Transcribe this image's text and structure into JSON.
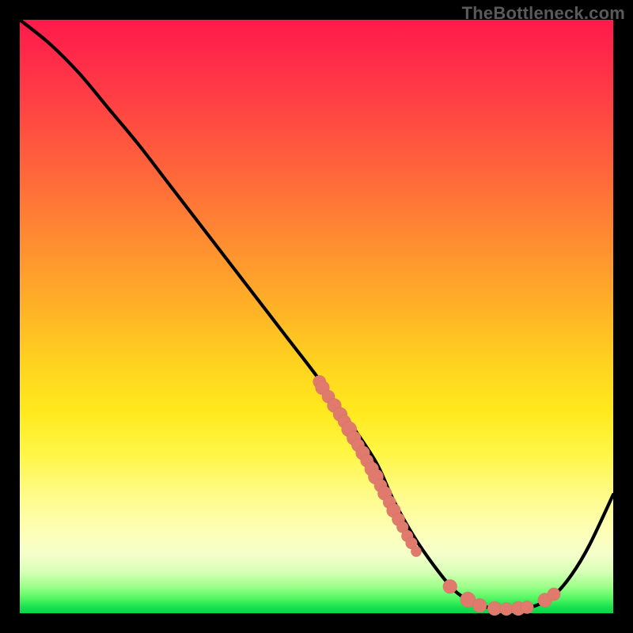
{
  "attribution": "TheBottleneck.com",
  "colors": {
    "dot": "#e07a6d",
    "line": "#000000"
  },
  "chart_data": {
    "type": "line",
    "title": "",
    "xlabel": "",
    "ylabel": "",
    "xlim": [
      0,
      100
    ],
    "ylim": [
      0,
      100
    ],
    "grid": false,
    "legend": false,
    "series": [
      {
        "name": "bottleneck-curve",
        "x": [
          0,
          5,
          10,
          15,
          20,
          25,
          30,
          35,
          40,
          45,
          50,
          55,
          60,
          63,
          67,
          72,
          75,
          78,
          81,
          84,
          87,
          90,
          93,
          96,
          100
        ],
        "y": [
          100,
          96,
          91,
          85,
          79,
          72.5,
          66,
          59.5,
          53,
          46.5,
          40,
          33,
          25.5,
          19,
          12,
          5.2,
          2.5,
          1.2,
          0.7,
          0.7,
          1.3,
          3.0,
          6.5,
          11.5,
          20
        ]
      }
    ],
    "scatter": [
      {
        "name": "sample-points",
        "points": [
          {
            "x": 50.5,
            "y": 39,
            "r": 1.1
          },
          {
            "x": 51.0,
            "y": 38,
            "r": 1.2
          },
          {
            "x": 52.0,
            "y": 36.5,
            "r": 1.1
          },
          {
            "x": 53.0,
            "y": 35,
            "r": 1.2
          },
          {
            "x": 54.0,
            "y": 33.5,
            "r": 1.2
          },
          {
            "x": 54.7,
            "y": 32.3,
            "r": 1.1
          },
          {
            "x": 55.5,
            "y": 31,
            "r": 1.3
          },
          {
            "x": 56.3,
            "y": 29.5,
            "r": 1.2
          },
          {
            "x": 57.0,
            "y": 28.3,
            "r": 1.1
          },
          {
            "x": 57.8,
            "y": 27,
            "r": 1.2
          },
          {
            "x": 58.5,
            "y": 25.7,
            "r": 1.1
          },
          {
            "x": 59.3,
            "y": 24.3,
            "r": 1.2
          },
          {
            "x": 60.0,
            "y": 23,
            "r": 1.3
          },
          {
            "x": 60.8,
            "y": 21.5,
            "r": 1.1
          },
          {
            "x": 61.5,
            "y": 20.2,
            "r": 1.2
          },
          {
            "x": 62.3,
            "y": 18.7,
            "r": 1.1
          },
          {
            "x": 63.0,
            "y": 17.3,
            "r": 1.2
          },
          {
            "x": 63.8,
            "y": 15.8,
            "r": 1.1
          },
          {
            "x": 64.5,
            "y": 14.5,
            "r": 1.0
          },
          {
            "x": 65.3,
            "y": 13,
            "r": 1.0
          },
          {
            "x": 66.0,
            "y": 11.8,
            "r": 1.0
          },
          {
            "x": 66.8,
            "y": 10.4,
            "r": 0.9
          },
          {
            "x": 72.5,
            "y": 4.5,
            "r": 1.2
          },
          {
            "x": 75.5,
            "y": 2.3,
            "r": 1.3
          },
          {
            "x": 77.5,
            "y": 1.3,
            "r": 1.2
          },
          {
            "x": 80.0,
            "y": 0.8,
            "r": 1.2
          },
          {
            "x": 82.0,
            "y": 0.7,
            "r": 1.1
          },
          {
            "x": 84.0,
            "y": 0.8,
            "r": 1.2
          },
          {
            "x": 85.5,
            "y": 1.0,
            "r": 1.1
          },
          {
            "x": 88.5,
            "y": 2.2,
            "r": 1.2
          },
          {
            "x": 90.0,
            "y": 3.2,
            "r": 1.1
          }
        ]
      }
    ]
  }
}
